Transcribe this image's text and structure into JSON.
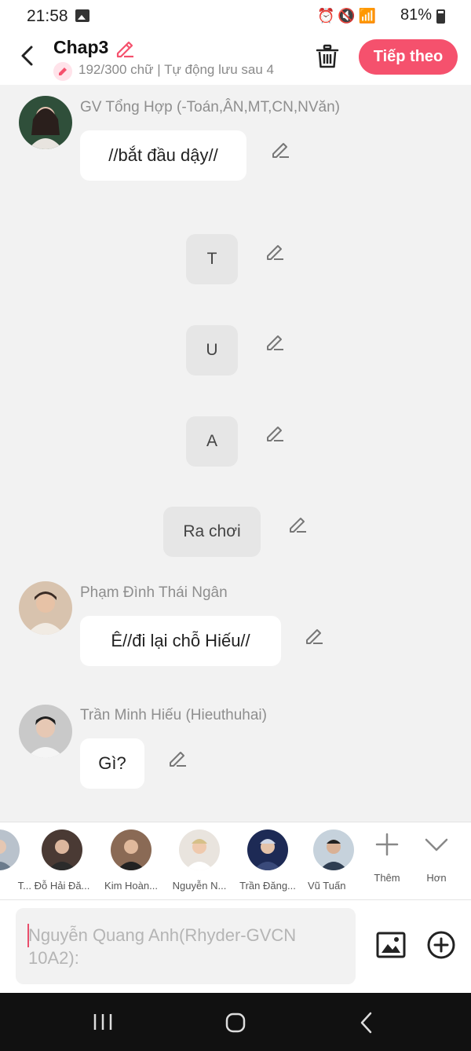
{
  "status_bar": {
    "time": "21:58",
    "battery": "81%"
  },
  "header": {
    "title": "Chap3",
    "subtitle": "192/300 chữ | Tự động lưu sau 4",
    "next_label": "Tiếp theo"
  },
  "messages": [
    {
      "sender": "GV Tổng Hợp (-Toán,ÂN,MT,CN,NVăn)",
      "text": "//bắt đầu dậy//"
    },
    {
      "text": "T"
    },
    {
      "text": "U"
    },
    {
      "text": "A"
    },
    {
      "text": "Ra chơi"
    },
    {
      "sender": "Phạm Đình Thái Ngân",
      "text": "Ê//đi lại chỗ Hiếu//"
    },
    {
      "sender": "Trần Minh Hiếu (Hieuthuhai)",
      "text": "Gì?"
    }
  ],
  "characters": [
    {
      "name": "T..."
    },
    {
      "name": "Đỗ Hải Đă..."
    },
    {
      "name": "Kim Hoàn..."
    },
    {
      "name": "Nguyễn N..."
    },
    {
      "name": "Trần Đăng..."
    },
    {
      "name": "Vũ Tuấn"
    }
  ],
  "strip_actions": {
    "add_label": "Thêm",
    "more_label": "Hơn"
  },
  "input": {
    "placeholder": "Nguyễn Quang Anh(Rhyder-GVCN 10A2):"
  },
  "icons": {
    "back": "chevron-left-icon",
    "edit": "pencil-icon",
    "delete": "trash-icon",
    "image": "image-icon",
    "add": "plus-circle-icon",
    "nav": [
      "recent-apps-icon",
      "home-icon",
      "nav-back-icon"
    ]
  },
  "colors": {
    "accent": "#f5516d",
    "background": "#f2f2f2",
    "bubble": "#ffffff",
    "narration": "#e6e6e6"
  }
}
